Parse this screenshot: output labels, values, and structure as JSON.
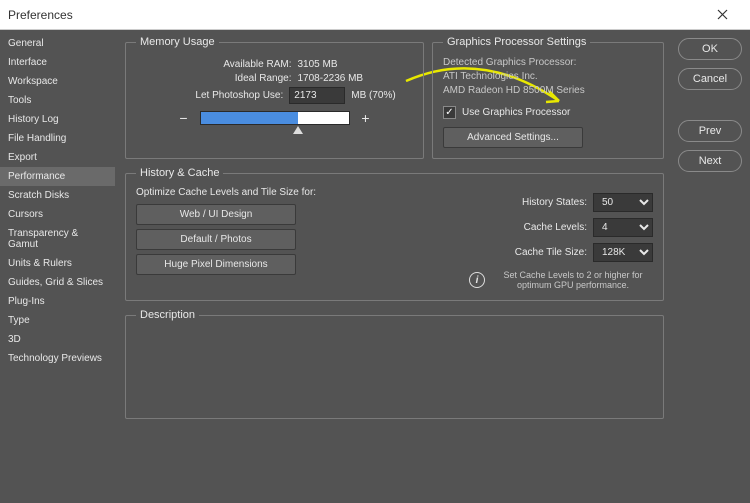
{
  "window": {
    "title": "Preferences"
  },
  "sidebar": {
    "items": [
      "General",
      "Interface",
      "Workspace",
      "Tools",
      "History Log",
      "File Handling",
      "Export",
      "Performance",
      "Scratch Disks",
      "Cursors",
      "Transparency & Gamut",
      "Units & Rulers",
      "Guides, Grid & Slices",
      "Plug-Ins",
      "Type",
      "3D",
      "Technology Previews"
    ],
    "active": "Performance"
  },
  "buttons": {
    "ok": "OK",
    "cancel": "Cancel",
    "prev": "Prev",
    "next": "Next"
  },
  "memory": {
    "legend": "Memory Usage",
    "available_label": "Available RAM:",
    "available_value": "3105 MB",
    "ideal_label": "Ideal Range:",
    "ideal_value": "1708-2236 MB",
    "let_label": "Let Photoshop Use:",
    "let_value": "2173",
    "let_suffix": "MB (70%)"
  },
  "gpu": {
    "legend": "Graphics Processor Settings",
    "detected_label": "Detected Graphics Processor:",
    "vendor": "ATI Technologies Inc.",
    "model": "AMD Radeon HD 8500M Series",
    "use_label": "Use Graphics Processor",
    "advanced": "Advanced Settings..."
  },
  "history": {
    "legend": "History & Cache",
    "optimize_label": "Optimize Cache Levels and Tile Size for:",
    "btn1": "Web / UI Design",
    "btn2": "Default / Photos",
    "btn3": "Huge Pixel Dimensions",
    "states_label": "History States:",
    "states_value": "50",
    "levels_label": "Cache Levels:",
    "levels_value": "4",
    "tile_label": "Cache Tile Size:",
    "tile_value": "128K",
    "hint": "Set Cache Levels to 2 or higher for optimum GPU performance."
  },
  "description": {
    "legend": "Description"
  }
}
